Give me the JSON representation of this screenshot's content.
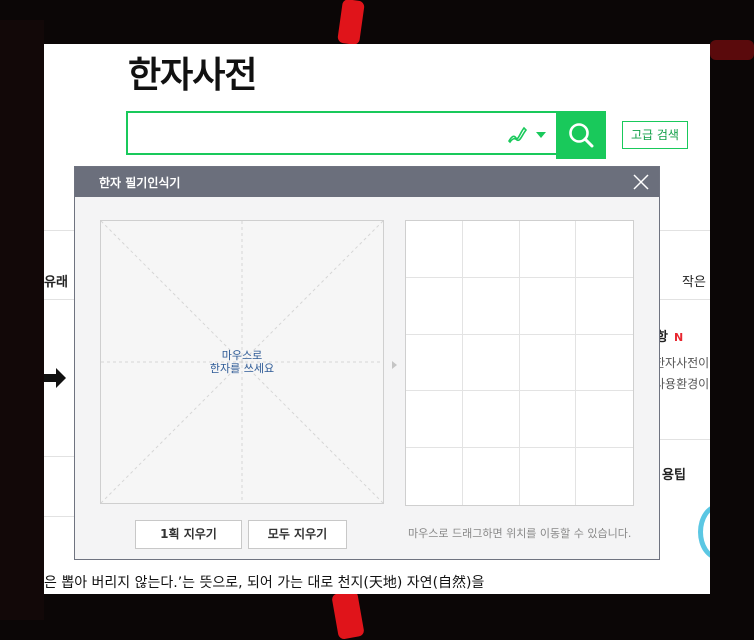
{
  "page": {
    "title": "한자사전",
    "advanced_search_label": "고급 검색",
    "side": {
      "left_tab": "유래",
      "right_tab": "작은",
      "notice_title": "항",
      "new_badge": "N",
      "notice_line1": "한자사전이",
      "notice_line2": "사용환경이",
      "tips_title": "용팁"
    },
    "body_text": "은 뽑아 버리지 않는다.’는 뜻으로, 되어 가는 대로 천지(天地) 자연(自然)을"
  },
  "dialog": {
    "title": "한자 필기인식기",
    "pad_hint_line1": "마우스로",
    "pad_hint_line2": "한자를 쓰세요",
    "undo_stroke_label": "1획 지우기",
    "clear_all_label": "모두 지우기",
    "drag_hint": "마우스로 드래그하면 위치를 이동할 수 있습니다."
  },
  "colors": {
    "accent": "#19c95b",
    "dialog_header": "#6b6f7c",
    "hint_text": "#2d5a96"
  }
}
